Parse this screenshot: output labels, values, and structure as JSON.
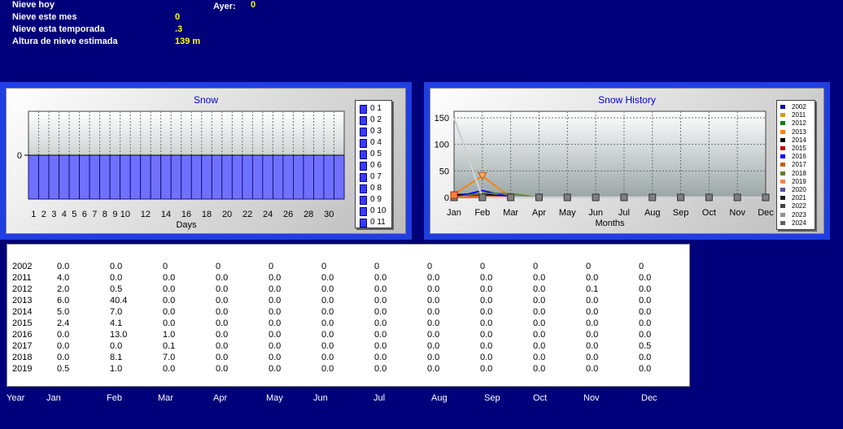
{
  "stats": {
    "nieve_hoy_label": "Nieve hoy",
    "ayer_label": "Ayer:",
    "ayer_value": "0",
    "mes_label": "Nieve este mes",
    "mes_value": "0",
    "temporada_label": "Nieve esta temporada",
    "temporada_value": ".3",
    "altura_label": "Altura de nieve estimada",
    "altura_value": "139 m"
  },
  "snow_chart": {
    "title": "Snow",
    "xlabel": "Days",
    "y_tick": "0",
    "x_ticks": [
      "1",
      "2",
      "3",
      "4",
      "5",
      "6",
      "7",
      "8",
      "9",
      "10",
      "12",
      "14",
      "16",
      "18",
      "20",
      "22",
      "24",
      "26",
      "28",
      "30"
    ],
    "legend": [
      "0 1",
      "0 2",
      "0 3",
      "0 4",
      "0 5",
      "0 6",
      "0 7",
      "0 8",
      "0 9",
      "0 10",
      "0 11"
    ],
    "legend_color": "#3a3aff"
  },
  "history_chart": {
    "title": "Snow History",
    "xlabel": "Months",
    "y_ticks": [
      "150",
      "100",
      "50",
      "0"
    ],
    "months": [
      "Jan",
      "Feb",
      "Mar",
      "Apr",
      "May",
      "Jun",
      "Jul",
      "Aug",
      "Sep",
      "Oct",
      "Nov",
      "Dec"
    ],
    "legend": [
      "2002",
      "2011",
      "2012",
      "2013",
      "2014",
      "2015",
      "2016",
      "2017",
      "2018",
      "2019",
      "2020",
      "2021",
      "2022",
      "2023",
      "2024"
    ]
  },
  "chart_data": [
    {
      "type": "bar",
      "title": "Snow",
      "xlabel": "Days",
      "ylabel": "",
      "categories": [
        "1",
        "2",
        "3",
        "4",
        "5",
        "6",
        "7",
        "8",
        "9",
        "10",
        "11",
        "12",
        "13",
        "14",
        "15",
        "16",
        "17",
        "18",
        "19",
        "20",
        "21",
        "22",
        "23",
        "24",
        "25",
        "26",
        "27",
        "28",
        "29",
        "30",
        "31"
      ],
      "values": [
        0,
        0,
        0,
        0,
        0,
        0,
        0,
        0,
        0,
        0,
        0,
        0,
        0,
        0,
        0,
        0,
        0,
        0,
        0,
        0,
        0,
        0,
        0,
        0,
        0,
        0,
        0,
        0,
        0,
        0,
        0
      ],
      "color": "#7070ff"
    },
    {
      "type": "line",
      "title": "Snow History",
      "xlabel": "Months",
      "ylabel": "",
      "ylim": [
        0,
        150
      ],
      "categories": [
        "Jan",
        "Feb",
        "Mar",
        "Apr",
        "May",
        "Jun",
        "Jul",
        "Aug",
        "Sep",
        "Oct",
        "Nov",
        "Dec"
      ],
      "grid": true,
      "legend_position": "right",
      "series": [
        {
          "name": "2002",
          "color": "#0000a0",
          "values": [
            0,
            0,
            0,
            0,
            0,
            0,
            0,
            0,
            0,
            0,
            0,
            0
          ]
        },
        {
          "name": "2011",
          "color": "#d0a000",
          "values": [
            4.0,
            0.0,
            0.0,
            0,
            0,
            0,
            0,
            0,
            0,
            0,
            0,
            0
          ]
        },
        {
          "name": "2012",
          "color": "#008000",
          "values": [
            2.0,
            0.5,
            0,
            0,
            0,
            0,
            0,
            0,
            0,
            0,
            0.1,
            0
          ]
        },
        {
          "name": "2013",
          "color": "#ff7f00",
          "values": [
            6.0,
            40.4,
            0,
            0,
            0,
            0,
            0,
            0,
            0,
            0,
            0,
            0
          ]
        },
        {
          "name": "2014",
          "color": "#000000",
          "values": [
            5.0,
            7.0,
            0,
            0,
            0,
            0,
            0,
            0,
            0,
            0,
            0,
            0
          ]
        },
        {
          "name": "2015",
          "color": "#c00000",
          "values": [
            2.4,
            4.1,
            0,
            0,
            0,
            0,
            0,
            0,
            0,
            0,
            0,
            0
          ]
        },
        {
          "name": "2016",
          "color": "#0000ff",
          "values": [
            0,
            13.0,
            1.0,
            0,
            0,
            0,
            0,
            0,
            0,
            0,
            0,
            0
          ]
        },
        {
          "name": "2017",
          "color": "#c06000",
          "values": [
            0,
            0,
            0.1,
            0,
            0,
            0,
            0,
            0,
            0,
            0,
            0,
            0.5
          ]
        },
        {
          "name": "2018",
          "color": "#608020",
          "values": [
            0,
            8.1,
            7.0,
            0,
            0,
            0,
            0,
            0,
            0,
            0,
            0,
            0
          ]
        },
        {
          "name": "2019",
          "color": "#ff8040",
          "values": [
            0.5,
            1.0,
            0,
            0,
            0,
            0,
            0,
            0,
            0,
            0,
            0,
            0
          ]
        },
        {
          "name": "2024",
          "color": "#d0d0d0",
          "values": [
            150,
            0,
            0,
            0,
            0,
            0,
            0,
            0,
            0,
            0,
            0,
            0
          ]
        }
      ]
    }
  ],
  "table": {
    "header": [
      "Year",
      "Jan",
      "Feb",
      "Mar",
      "Apr",
      "May",
      "Jun",
      "Jul",
      "Aug",
      "Sep",
      "Oct",
      "Nov",
      "Dec"
    ],
    "rows": [
      [
        "2002",
        "0.0",
        "0.0",
        "0",
        "0",
        "0",
        "0",
        "0",
        "0",
        "0",
        "0",
        "0",
        "0"
      ],
      [
        "2011",
        "4.0",
        "0.0",
        "0.0",
        "0.0",
        "0.0",
        "0.0",
        "0.0",
        "0.0",
        "0.0",
        "0.0",
        "0.0",
        "0.0"
      ],
      [
        "2012",
        "2.0",
        "0.5",
        "0.0",
        "0.0",
        "0.0",
        "0.0",
        "0.0",
        "0.0",
        "0.0",
        "0.0",
        "0.1",
        "0.0"
      ],
      [
        "2013",
        "6.0",
        "40.4",
        "0.0",
        "0.0",
        "0.0",
        "0.0",
        "0.0",
        "0.0",
        "0.0",
        "0.0",
        "0.0",
        "0.0"
      ],
      [
        "2014",
        "5.0",
        "7.0",
        "0.0",
        "0.0",
        "0.0",
        "0.0",
        "0.0",
        "0.0",
        "0.0",
        "0.0",
        "0.0",
        "0.0"
      ],
      [
        "2015",
        "2.4",
        "4.1",
        "0.0",
        "0.0",
        "0.0",
        "0.0",
        "0.0",
        "0.0",
        "0.0",
        "0.0",
        "0.0",
        "0.0"
      ],
      [
        "2016",
        "0.0",
        "13.0",
        "1.0",
        "0.0",
        "0.0",
        "0.0",
        "0.0",
        "0.0",
        "0.0",
        "0.0",
        "0.0",
        "0.0"
      ],
      [
        "2017",
        "0.0",
        "0.0",
        "0.1",
        "0.0",
        "0.0",
        "0.0",
        "0.0",
        "0.0",
        "0.0",
        "0.0",
        "0.0",
        "0.5"
      ],
      [
        "2018",
        "0.0",
        "8.1",
        "7.0",
        "0.0",
        "0.0",
        "0.0",
        "0.0",
        "0.0",
        "0.0",
        "0.0",
        "0.0",
        "0.0"
      ],
      [
        "2019",
        "0.5",
        "1.0",
        "0.0",
        "0.0",
        "0.0",
        "0.0",
        "0.0",
        "0.0",
        "0.0",
        "0.0",
        "0.0",
        "0.0"
      ]
    ]
  }
}
